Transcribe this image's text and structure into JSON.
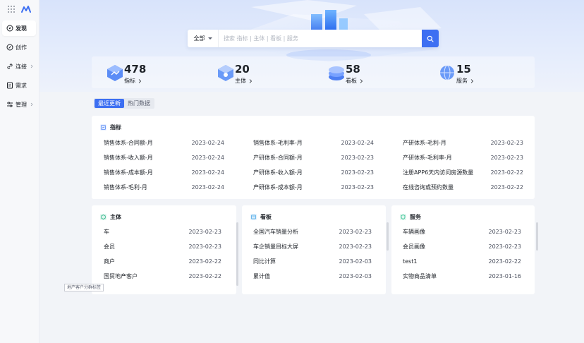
{
  "sidebar": {
    "items": [
      {
        "label": "发现",
        "active": true,
        "icon": "discover-icon"
      },
      {
        "label": "创作",
        "active": false,
        "icon": "create-icon"
      },
      {
        "label": "连接",
        "active": false,
        "icon": "link-icon",
        "has_submenu": true
      },
      {
        "label": "需求",
        "active": false,
        "icon": "request-icon"
      },
      {
        "label": "管理",
        "active": false,
        "icon": "manage-icon",
        "has_submenu": true
      }
    ]
  },
  "search": {
    "scope": "全部",
    "placeholder": "搜索 指标 | 主体 | 看板 | 服务"
  },
  "stats": [
    {
      "value": "478",
      "label": "指标"
    },
    {
      "value": "20",
      "label": "主体"
    },
    {
      "value": "58",
      "label": "看板"
    },
    {
      "value": "15",
      "label": "服务"
    }
  ],
  "tabs": [
    {
      "label": "最近更新",
      "active": true
    },
    {
      "label": "热门数据",
      "active": false
    }
  ],
  "metrics": {
    "title": "指标",
    "columns": [
      [
        {
          "name": "销售体系-合同额-月",
          "date": "2023-02-24"
        },
        {
          "name": "销售体系-收入额-月",
          "date": "2023-02-24"
        },
        {
          "name": "销售体系-成本额-月",
          "date": "2023-02-24"
        },
        {
          "name": "销售体系-毛利-月",
          "date": "2023-02-24"
        }
      ],
      [
        {
          "name": "销售体系-毛利率-月",
          "date": "2023-02-24"
        },
        {
          "name": "产研体系-合同额-月",
          "date": "2023-02-23"
        },
        {
          "name": "产研体系-收入额-月",
          "date": "2023-02-23"
        },
        {
          "name": "产研体系-成本额-月",
          "date": "2023-02-23"
        }
      ],
      [
        {
          "name": "产研体系-毛利-月",
          "date": "2023-02-23"
        },
        {
          "name": "产研体系-毛利率-月",
          "date": "2023-02-23"
        },
        {
          "name": "注册APP6天内访问房源数量",
          "date": "2023-02-22"
        },
        {
          "name": "在线咨询或预约数量",
          "date": "2023-02-22"
        }
      ]
    ]
  },
  "entity": {
    "title": "主体",
    "rows": [
      {
        "name": "车",
        "date": "2023-02-23"
      },
      {
        "name": "会员",
        "date": "2023-02-23"
      },
      {
        "name": "商户",
        "date": "2023-02-22"
      },
      {
        "name": "国贸地产客户",
        "date": "2023-02-22"
      }
    ],
    "tooltip": "地产客户分群标签"
  },
  "board": {
    "title": "看板",
    "rows": [
      {
        "name": "全国汽车销量分析",
        "date": "2023-02-23"
      },
      {
        "name": "车企销量目标大屏",
        "date": "2023-02-23"
      },
      {
        "name": "同比计算",
        "date": "2023-02-03"
      },
      {
        "name": "累计值",
        "date": "2023-02-03"
      }
    ]
  },
  "service": {
    "title": "服务",
    "rows": [
      {
        "name": "车辆画像",
        "date": "2023-02-23"
      },
      {
        "name": "会员画像",
        "date": "2023-02-23"
      },
      {
        "name": "test1",
        "date": "2023-02-22"
      },
      {
        "name": "实物商品清单",
        "date": "2023-01-16"
      }
    ]
  },
  "colors": {
    "primary": "#3d6ff2",
    "metric_icon": "#5b8cf6",
    "entity_icon": "#30b78a",
    "board_icon": "#4aa8e8",
    "service_icon": "#2fbf8f"
  }
}
